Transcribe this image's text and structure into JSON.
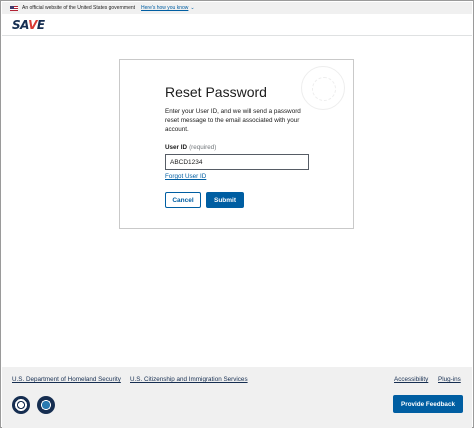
{
  "gov_banner": {
    "text": "An official website of the United States government",
    "link": "Here's how you know"
  },
  "header": {
    "logo_prefix": "SA",
    "logo_v": "V",
    "logo_suffix": "E"
  },
  "card": {
    "title": "Reset Password",
    "description": "Enter your User ID, and we will send a password reset message to the email associated with your account.",
    "field_label": "User ID",
    "field_required": "(required)",
    "field_value": "ABCD1234",
    "forgot_link": "Forgot User ID",
    "cancel_label": "Cancel",
    "submit_label": "Submit"
  },
  "footer": {
    "links": [
      "U.S. Department of Homeland Security",
      "U.S. Citizenship and Immigration Services"
    ],
    "right_links": [
      "Accessibility",
      "Plug-ins"
    ],
    "feedback_label": "Provide Feedback"
  },
  "colors": {
    "primary": "#005ea2",
    "navy": "#162e51",
    "footer_bg": "#f0f0f0"
  }
}
